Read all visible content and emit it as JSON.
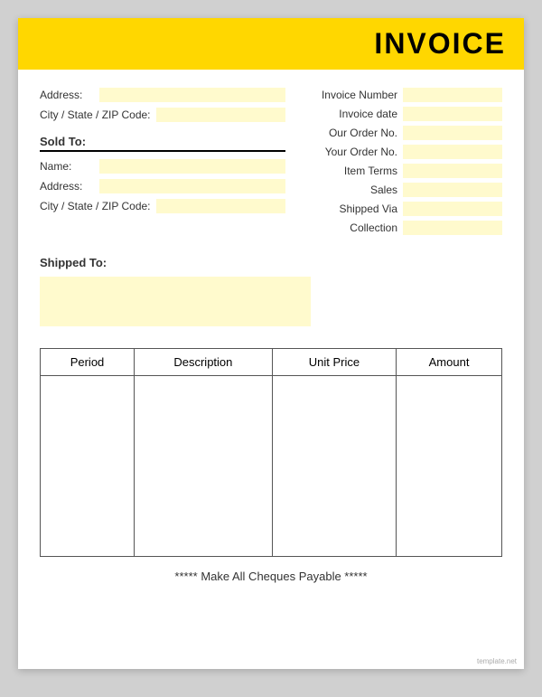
{
  "header": {
    "title": "INVOICE"
  },
  "left_fields": {
    "address_label": "Address:",
    "city_label": "City / State / ZIP Code:"
  },
  "sold_to": {
    "label": "Sold To:",
    "name_label": "Name:",
    "address_label": "Address:",
    "city_label": "City / State / ZIP Code:"
  },
  "right_fields": [
    {
      "label": "Invoice Number"
    },
    {
      "label": "Invoice date"
    },
    {
      "label": "Our Order No."
    },
    {
      "label": "Your Order No."
    },
    {
      "label": "Item Terms"
    },
    {
      "label": "Sales"
    },
    {
      "label": "Shipped Via"
    },
    {
      "label": "Collection"
    }
  ],
  "shipped_to": {
    "label": "Shipped To:"
  },
  "table": {
    "columns": [
      "Period",
      "Description",
      "Unit Price",
      "Amount"
    ]
  },
  "footer": {
    "text": "***** Make All Cheques Payable *****"
  },
  "watermark": "template.net"
}
